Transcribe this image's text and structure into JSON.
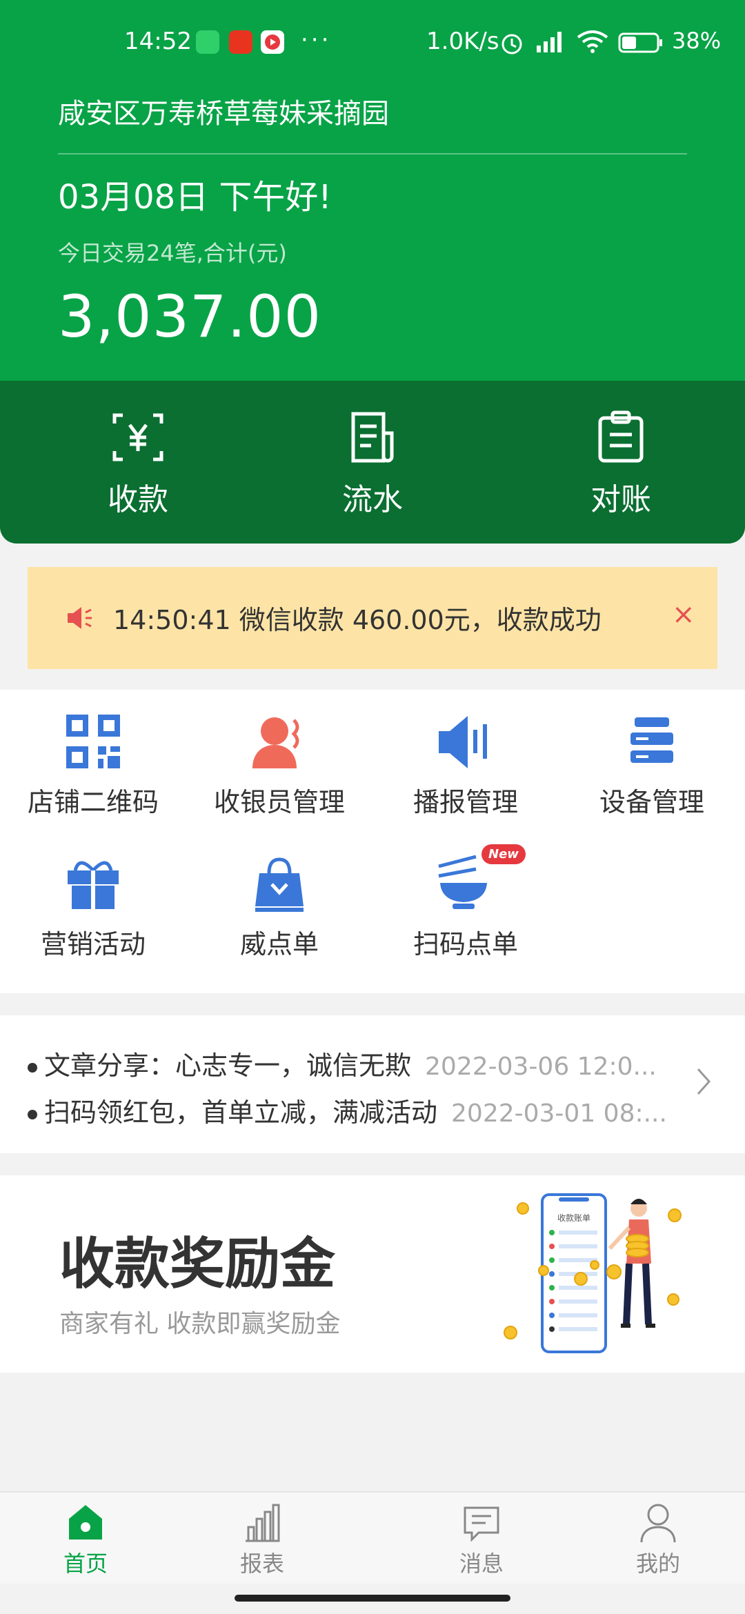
{
  "status_bar": {
    "time": "14:52",
    "more": "···",
    "net_speed": "1.0K/s",
    "battery": "38%"
  },
  "header": {
    "store_name": "咸安区万寿桥草莓妹采摘园",
    "greeting": "03月08日 下午好!",
    "summary": "今日交易24笔,合计(元)",
    "amount": "3,037.00"
  },
  "actions": [
    {
      "label": "收款",
      "icon": "yuan-scan-icon"
    },
    {
      "label": "流水",
      "icon": "document-icon"
    },
    {
      "label": "对账",
      "icon": "clipboard-icon"
    }
  ],
  "notice": {
    "text": "14:50:41 微信收款 460.00元，收款成功",
    "close": "×"
  },
  "grid": [
    {
      "label": "店铺二维码",
      "icon": "qr-code-icon"
    },
    {
      "label": "收银员管理",
      "icon": "cashier-icon"
    },
    {
      "label": "播报管理",
      "icon": "speaker-icon"
    },
    {
      "label": "设备管理",
      "icon": "server-icon"
    },
    {
      "label": "营销活动",
      "icon": "gift-icon"
    },
    {
      "label": "威点单",
      "icon": "shopping-bag-icon"
    },
    {
      "label": "扫码点单",
      "icon": "noodle-bowl-icon",
      "badge": "New"
    }
  ],
  "news": [
    {
      "title": "文章分享：心志专一，诚信无欺",
      "date": "2022-03-06 12:0..."
    },
    {
      "title": "扫码领红包，首单立减，满减活动",
      "date": "2022-03-01 08:..."
    }
  ],
  "reward": {
    "title": "收款奖励金",
    "subtitle": "商家有礼 收款即赢奖励金",
    "phone_label": "收款账单"
  },
  "bottom_nav": [
    {
      "label": "首页",
      "icon": "home-icon",
      "active": true
    },
    {
      "label": "报表",
      "icon": "bar-chart-icon",
      "active": false
    },
    {
      "label": "消息",
      "icon": "message-icon",
      "active": false
    },
    {
      "label": "我的",
      "icon": "user-icon",
      "active": false
    }
  ],
  "colors": {
    "brand_green": "#08a347",
    "dark_green": "#0a6f31",
    "notice_bg": "#fde4a6",
    "icon_blue": "#3a77d8",
    "accent_red": "#e65050"
  }
}
